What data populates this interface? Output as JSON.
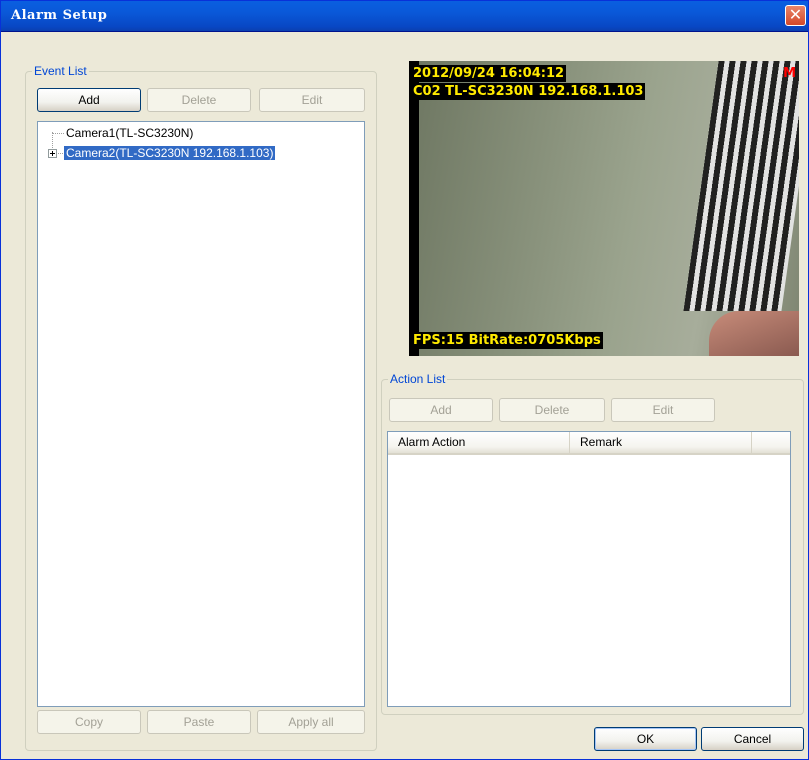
{
  "window": {
    "title": "Alarm Setup",
    "close_glyph": "✕"
  },
  "event_list": {
    "label": "Event List",
    "buttons": {
      "add": "Add",
      "delete": "Delete",
      "edit": "Edit"
    },
    "tree": [
      {
        "label": "Camera1(TL-SC3230N)",
        "selected": false,
        "expandable": false
      },
      {
        "label": "Camera2(TL-SC3230N 192.168.1.103)",
        "selected": true,
        "expandable": true
      }
    ],
    "bottom_buttons": {
      "copy": "Copy",
      "paste": "Paste",
      "apply_all": "Apply all"
    }
  },
  "video": {
    "timestamp": "2012/09/24 16:04:12",
    "camera_info": "C02 TL-SC3230N 192.168.1.103",
    "stats": "FPS:15 BitRate:0705Kbps",
    "motion_flag": "M"
  },
  "action_list": {
    "label": "Action List",
    "buttons": {
      "add": "Add",
      "delete": "Delete",
      "edit": "Edit"
    },
    "columns": [
      "Alarm Action",
      "Remark"
    ]
  },
  "dialog_buttons": {
    "ok": "OK",
    "cancel": "Cancel"
  }
}
